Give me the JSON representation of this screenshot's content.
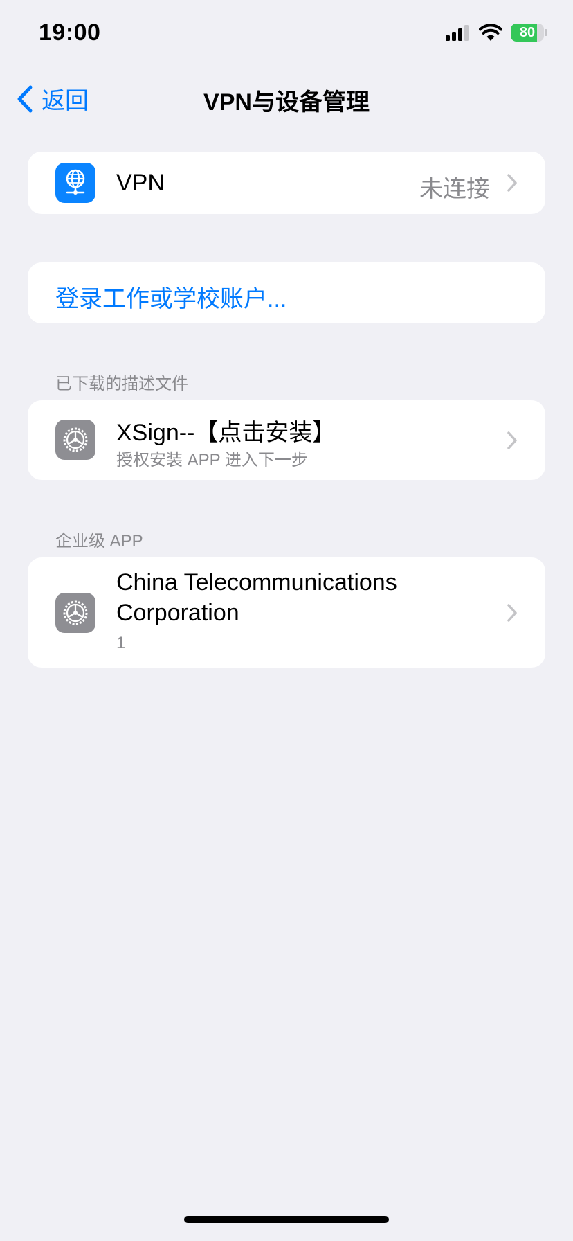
{
  "status_bar": {
    "time": "19:00",
    "battery_level": 80,
    "battery_text": "80"
  },
  "nav": {
    "back_label": "返回",
    "title": "VPN与设备管理"
  },
  "vpn": {
    "label": "VPN",
    "status": "未连接",
    "icon": "globe-network-icon"
  },
  "login": {
    "label": "登录工作或学校账户..."
  },
  "profiles": {
    "header": "已下载的描述文件",
    "items": [
      {
        "title": "XSign--【点击安装】",
        "subtitle": "授权安装 APP 进入下一步",
        "icon": "settings-gear-icon"
      }
    ]
  },
  "enterprise": {
    "header": "企业级 APP",
    "items": [
      {
        "title": "China Telecommunications Corporation",
        "subtitle": "1",
        "icon": "settings-gear-icon"
      }
    ]
  },
  "colors": {
    "accent": "#007aff",
    "background": "#f0f0f5",
    "battery": "#34c759",
    "secondary_text": "#8a8a8e"
  }
}
